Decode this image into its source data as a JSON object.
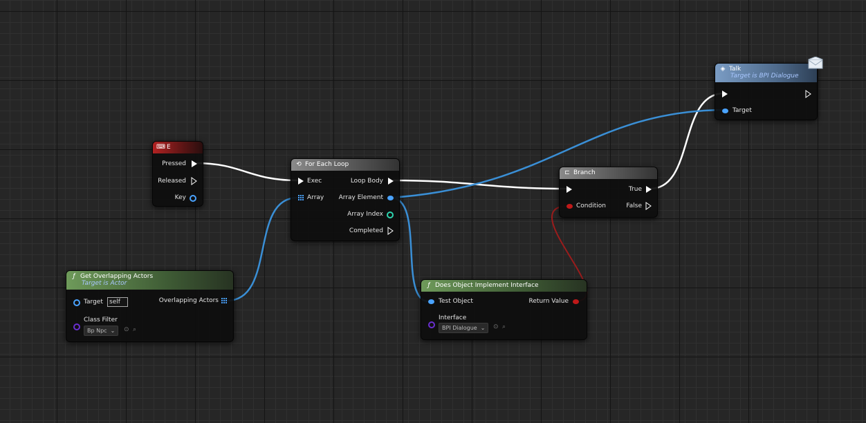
{
  "colors": {
    "exec_wire": "#ffffff",
    "object_wire": "#3a8fd6",
    "bool_wire": "#9b1c1c",
    "object_pin": "#4aa3ff",
    "bool_pin": "#c01919",
    "int_pin": "#2ed6b0",
    "class_pin": "#6a2fd1"
  },
  "nodes": {
    "key_e": {
      "title": "E",
      "icon": "keyboard-icon",
      "pins": {
        "pressed": "Pressed",
        "released": "Released",
        "key": "Key"
      }
    },
    "for_each": {
      "title": "For Each Loop",
      "icon": "loop-icon",
      "pins": {
        "exec": "Exec",
        "array": "Array",
        "loop_body": "Loop Body",
        "array_element": "Array Element",
        "array_index": "Array Index",
        "completed": "Completed"
      }
    },
    "get_overlapping": {
      "title": "Get Overlapping Actors",
      "subtitle": "Target is Actor",
      "icon": "function-icon",
      "pins": {
        "target": "Target",
        "target_value": "self",
        "overlapping": "Overlapping Actors",
        "class_filter": "Class Filter",
        "class_filter_value": "Bp Npc"
      }
    },
    "does_implement": {
      "title": "Does Object Implement Interface",
      "icon": "function-icon",
      "pins": {
        "test_object": "Test Object",
        "return_value": "Return Value",
        "interface": "Interface",
        "interface_value": "BPI Dialogue"
      }
    },
    "branch": {
      "title": "Branch",
      "icon": "branch-icon",
      "pins": {
        "condition": "Condition",
        "true": "True",
        "false": "False"
      }
    },
    "talk": {
      "title": "Talk",
      "subtitle": "Target is BPI Dialogue",
      "icon": "message-icon",
      "pins": {
        "target": "Target"
      }
    }
  }
}
